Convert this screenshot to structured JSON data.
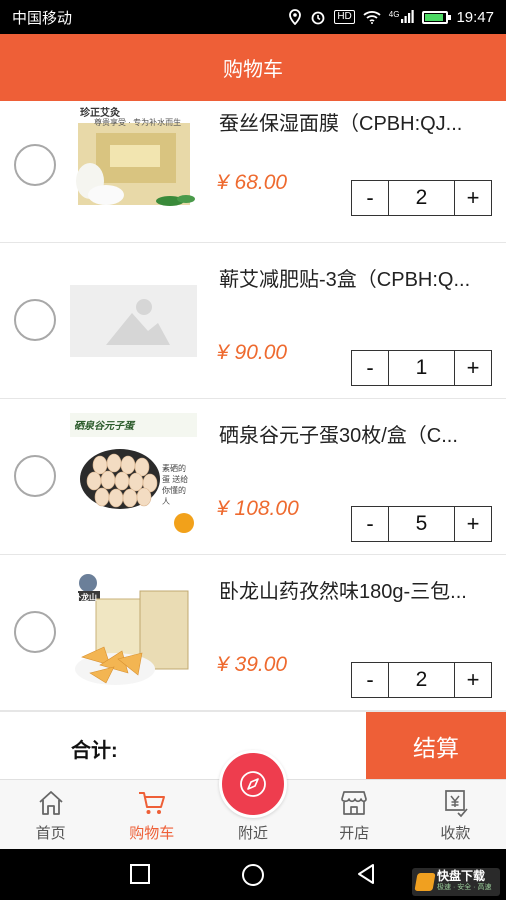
{
  "status_bar": {
    "carrier": "中国移动",
    "network": "4G",
    "hd": "HD",
    "time": "19:47"
  },
  "header": {
    "title": "购物车"
  },
  "items": [
    {
      "title": "蚕丝保湿面膜（CPBH:QJ...",
      "price": "¥ 68.00",
      "qty": "2",
      "minus": "-",
      "plus": "+",
      "image_brand": "珍正艾灸",
      "image_text": "尊贵享受 · 专为补水而生"
    },
    {
      "title": "蕲艾减肥贴-3盒（CPBH:Q...",
      "price": "¥ 90.00",
      "qty": "1",
      "minus": "-",
      "plus": "+"
    },
    {
      "title": "硒泉谷元子蛋30枚/盒（C...",
      "price": "¥ 108.00",
      "qty": "5",
      "minus": "-",
      "plus": "+",
      "image_brand": "硒泉谷元子蛋",
      "image_text": "素硒的蛋 送给你懂的人"
    },
    {
      "title": "卧龙山药孜然味180g-三包...",
      "price": "¥ 39.00",
      "qty": "2",
      "minus": "-",
      "plus": "+",
      "image_brand": "卧龙山"
    }
  ],
  "total": {
    "label": "合计:",
    "checkout": "结算"
  },
  "tabs": [
    {
      "label": "首页",
      "icon": "home-icon"
    },
    {
      "label": "购物车",
      "icon": "cart-icon"
    },
    {
      "label": "附近",
      "icon": "compass-icon"
    },
    {
      "label": "开店",
      "icon": "shop-icon"
    },
    {
      "label": "收款",
      "icon": "receipt-icon"
    }
  ],
  "watermark": {
    "name": "快盘下载",
    "tagline": "极速 · 安全 · 高速"
  },
  "colors": {
    "accent": "#ee5f37",
    "price": "#ee6a2f",
    "center_button": "#ee3d4e"
  }
}
